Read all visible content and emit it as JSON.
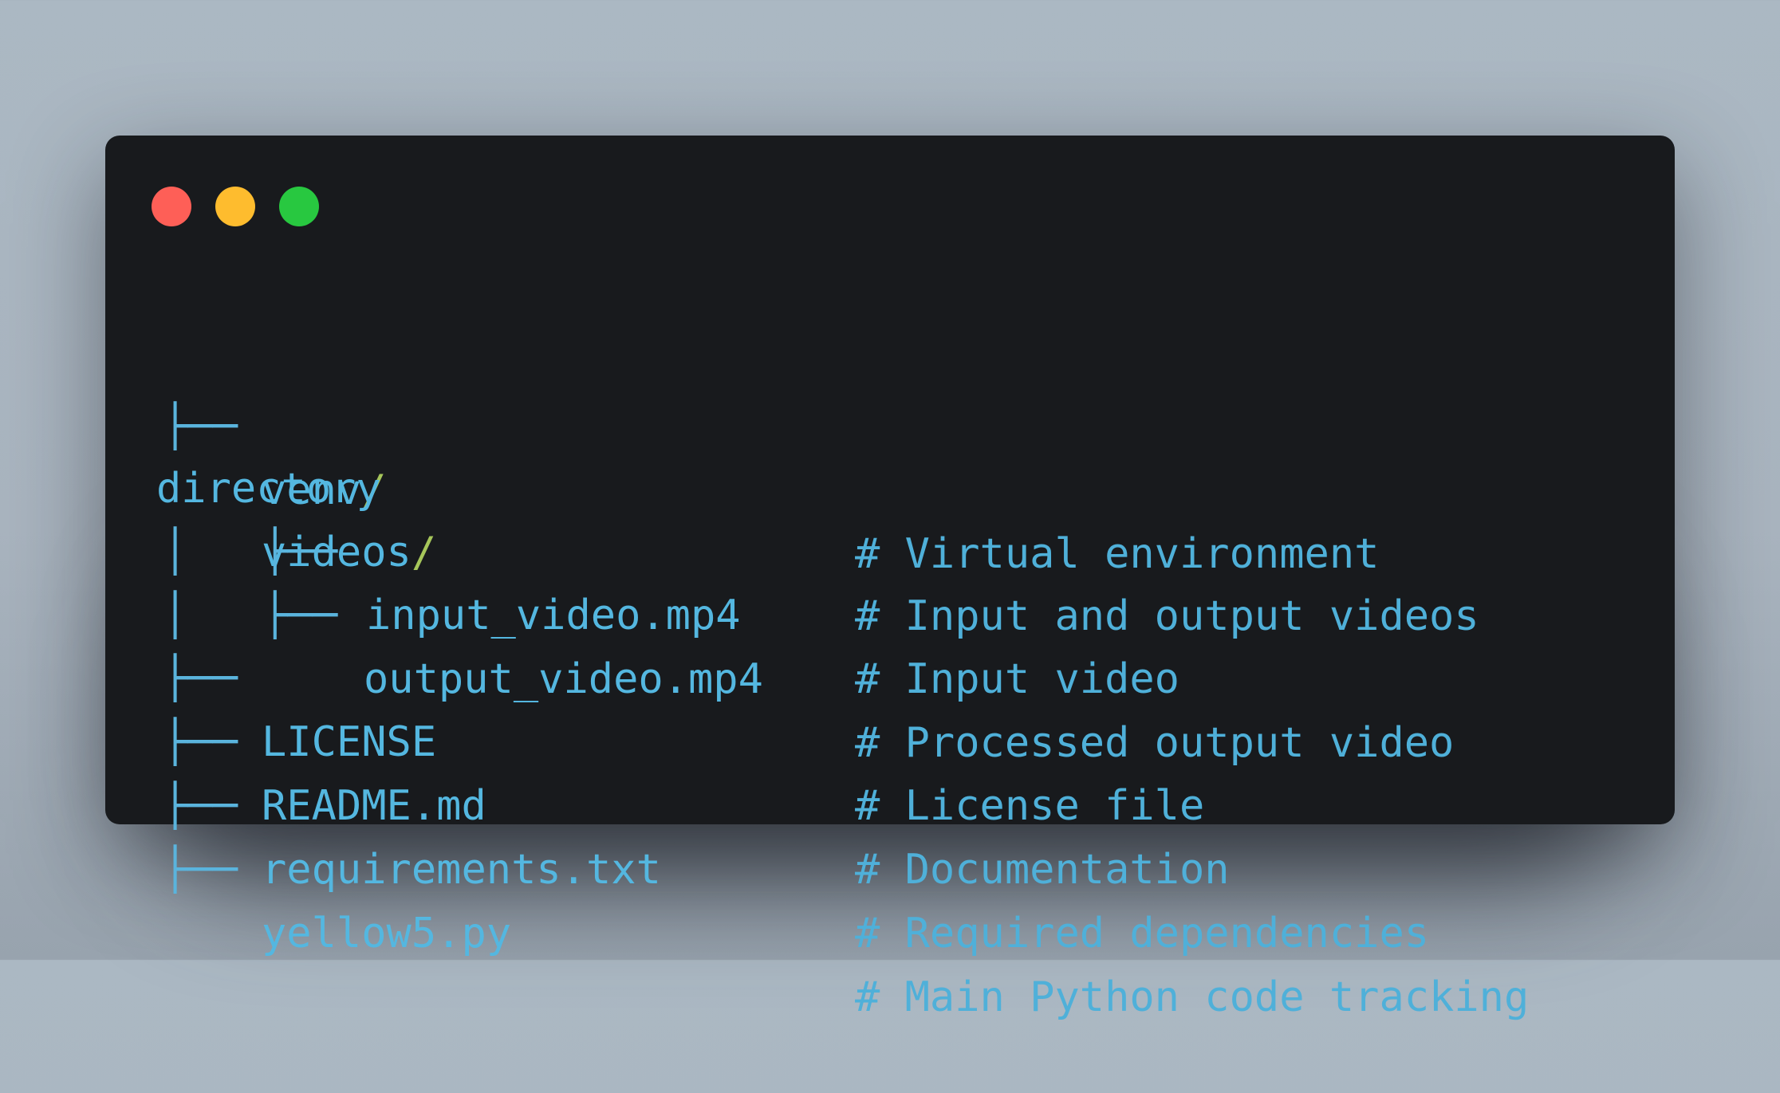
{
  "window": {
    "controls": [
      "close",
      "minimize",
      "maximize"
    ]
  },
  "tree": [
    {
      "branch": "├── ",
      "name": "venv",
      "slash": "/",
      "comment": "# Virtual environment"
    },
    {
      "branch": "",
      "name": "directory",
      "overlay": "videos",
      "slash": "/",
      "comment": "# Input and output videos"
    },
    {
      "branch": "│   ├── ",
      "name": "input_video.mp4",
      "slash": "",
      "comment": "# Input video"
    },
    {
      "branch": "│   ├── ",
      "name": "output_video.mp4",
      "slash": "",
      "comment": "# Processed output video"
    },
    {
      "branch": "├── ",
      "name": "LICENSE",
      "slash": "",
      "comment": "# License file"
    },
    {
      "branch": "├── ",
      "name": "README.md",
      "slash": "",
      "comment": "# Documentation"
    },
    {
      "branch": "├── ",
      "name": "requirements.txt",
      "slash": "",
      "comment": "# Required dependencies"
    },
    {
      "branch": "├── ",
      "name": "yellow5.py",
      "slash": "",
      "comment": "# Main Python code tracking"
    }
  ]
}
